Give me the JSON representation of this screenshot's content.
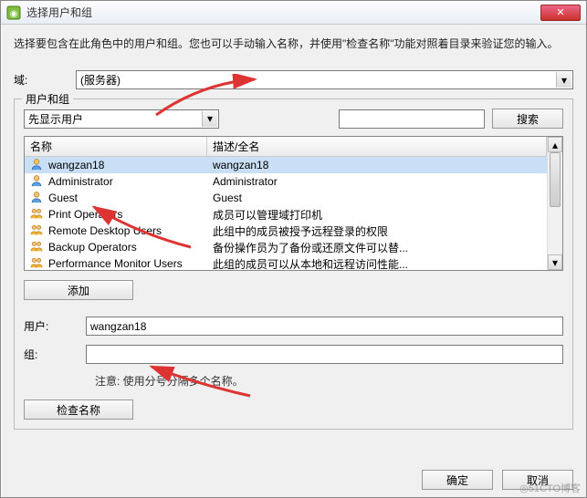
{
  "window": {
    "title": "选择用户和组",
    "close_label": "✕"
  },
  "instruction": "选择要包含在此角色中的用户和组。您也可以手动输入名称，并使用\"检查名称\"功能对照着目录来验证您的输入。",
  "domain": {
    "label": "域:",
    "value": "(服务器)"
  },
  "fieldset": {
    "legend": "用户和组"
  },
  "filter": {
    "dropdown_value": "先显示用户",
    "search_label": "搜索",
    "search_value": ""
  },
  "columns": {
    "name": "名称",
    "desc": "描述/全名"
  },
  "rows": [
    {
      "icon": "user",
      "name": "wangzan18",
      "desc": "wangzan18",
      "selected": true
    },
    {
      "icon": "user",
      "name": "Administrator",
      "desc": "Administrator"
    },
    {
      "icon": "user",
      "name": "Guest",
      "desc": "Guest"
    },
    {
      "icon": "group",
      "name": "Print Operators",
      "desc": "成员可以管理域打印机"
    },
    {
      "icon": "group",
      "name": "Remote Desktop Users",
      "desc": "此组中的成员被授予远程登录的权限"
    },
    {
      "icon": "group",
      "name": "Backup Operators",
      "desc": "备份操作员为了备份或还原文件可以替..."
    },
    {
      "icon": "group",
      "name": "Performance Monitor Users",
      "desc": "此组的成员可以从本地和远程访问性能..."
    }
  ],
  "add_label": "添加",
  "user_field": {
    "label": "用户:",
    "value": "wangzan18"
  },
  "group_field": {
    "label": "组:",
    "value": ""
  },
  "note": "注意: 使用分号分隔多个名称。",
  "check_label": "检查名称",
  "buttons": {
    "ok": "确定",
    "cancel": "取消"
  },
  "watermark": "◎51CTO博客"
}
